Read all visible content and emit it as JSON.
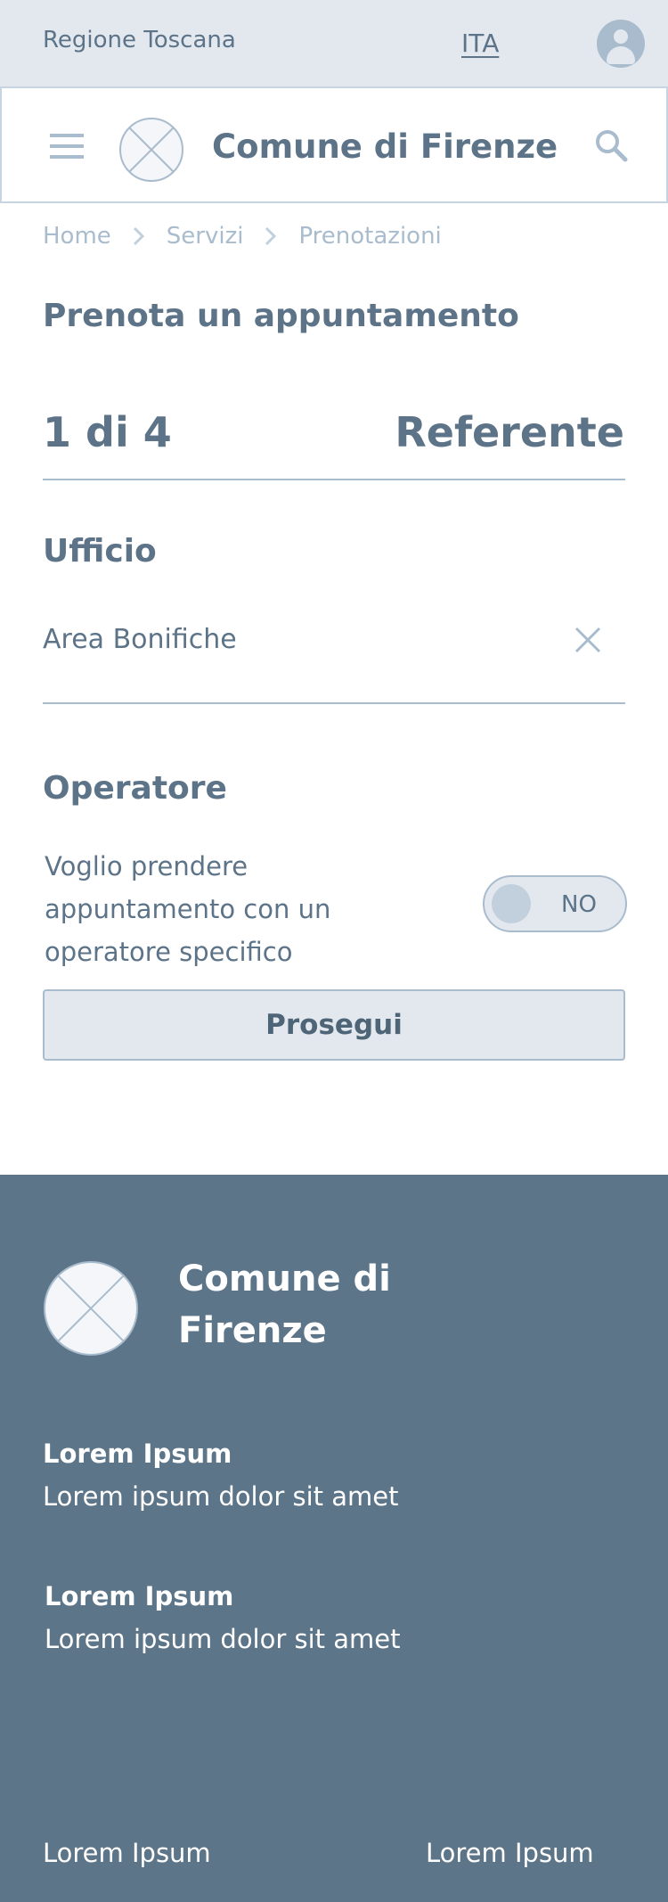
{
  "topbar": {
    "region": "Regione Toscana",
    "language": "ITA",
    "user_icon": "user-avatar-icon"
  },
  "header": {
    "title": "Comune di Firenze",
    "menu_icon": "hamburger-menu-icon",
    "logo_icon": "logo-placeholder-icon",
    "search_icon": "search-icon"
  },
  "breadcrumb": {
    "items": [
      "Home",
      "Servizi",
      "Prenotazioni"
    ]
  },
  "page": {
    "title": "Prenota un appuntamento"
  },
  "steps": {
    "count_label": "1 di 4",
    "current_step": 1,
    "total_steps": 4,
    "name": "Referente"
  },
  "ufficio": {
    "label": "Ufficio",
    "value": "Area Bonifiche"
  },
  "operatore": {
    "label": "Operatore",
    "text": "Voglio prendere appuntamento con un operatore specifico",
    "toggle_state": "NO"
  },
  "actions": {
    "continue_label": "Prosegui"
  },
  "footer": {
    "brand": "Comune di Firenze",
    "blocks": [
      {
        "title": "Lorem Ipsum",
        "text": "Lorem ipsum dolor sit amet"
      },
      {
        "title": "Lorem Ipsum",
        "text": "Lorem ipsum dolor sit amet"
      }
    ],
    "links": [
      "Lorem Ipsum",
      "Lorem Ipsum"
    ]
  },
  "colors": {
    "primary": "#5c7388",
    "light": "#e3e8ef",
    "muted": "#a9bccd",
    "footer_bg": "#5c7589"
  }
}
